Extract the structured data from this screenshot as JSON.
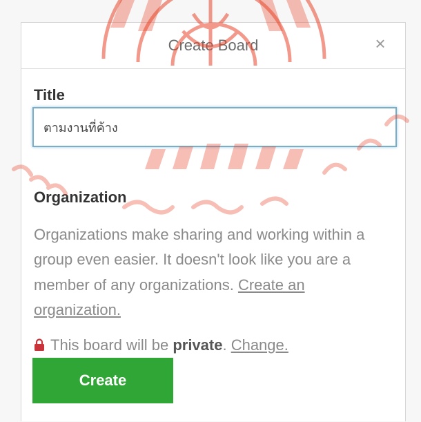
{
  "dialog": {
    "title": "Create Board",
    "close_icon": "close-icon",
    "close_glyph": "×"
  },
  "title_field": {
    "label": "Title",
    "value": "ตามงานที่ค้าง"
  },
  "organization": {
    "label": "Organization",
    "description": "Organizations make sharing and working within a group even easier. It doesn't look like you are a member of any organizations. ",
    "create_link": "Create an organization."
  },
  "privacy": {
    "icon": "lock-icon",
    "prefix": "This board will be ",
    "level": "private",
    "suffix": ". ",
    "change_link": "Change."
  },
  "create_button": {
    "label": "Create"
  },
  "colors": {
    "button_green": "#2fa636",
    "lock_red": "#c9343a",
    "input_border": "#7aaec8",
    "watermark": "#e8472d"
  }
}
